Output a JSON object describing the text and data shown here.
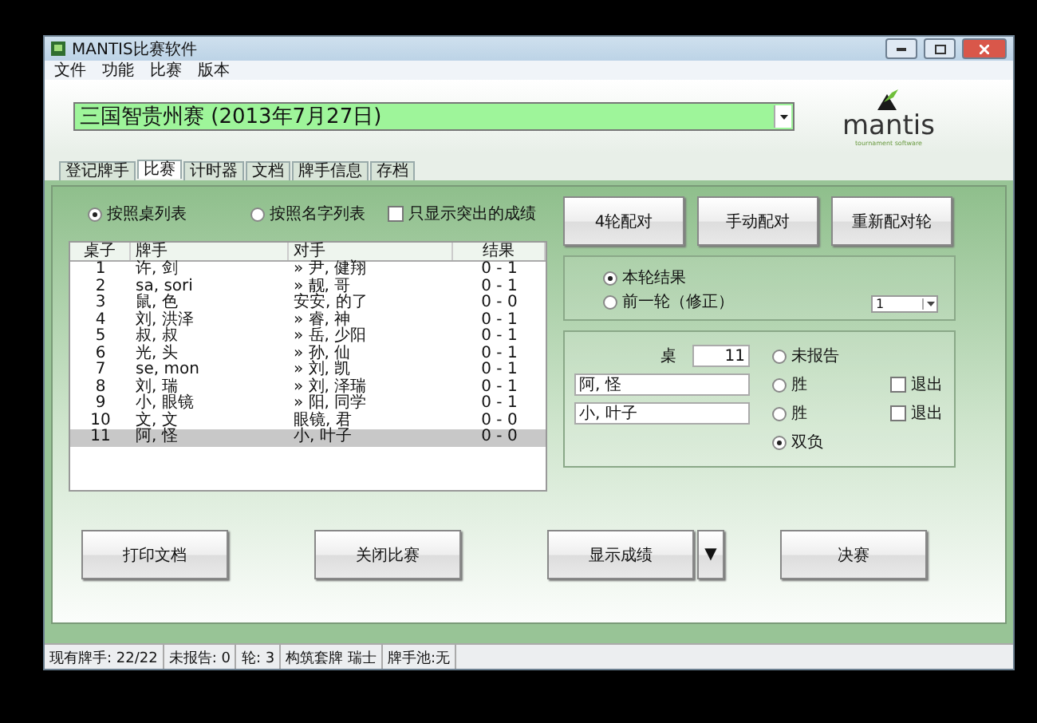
{
  "window": {
    "title": "MANTIS比赛软件"
  },
  "menu": [
    "文件",
    "功能",
    "比赛",
    "版本"
  ],
  "event_select": {
    "value": "三国智贵州赛 (2013年7月27日)"
  },
  "logo": {
    "name": "mantis",
    "tagline": "tournament software"
  },
  "tabs": [
    {
      "label": "登记牌手",
      "selected": false
    },
    {
      "label": "比赛",
      "selected": true
    },
    {
      "label": "计时器",
      "selected": false
    },
    {
      "label": "文档",
      "selected": false
    },
    {
      "label": "牌手信息",
      "selected": false
    },
    {
      "label": "存档",
      "selected": false
    }
  ],
  "sort_options": [
    {
      "label": "按照桌列表",
      "selected": true
    },
    {
      "label": "按照名字列表",
      "selected": false
    }
  ],
  "highlight_only": {
    "label": "只显示突出的成绩",
    "checked": false
  },
  "table": {
    "columns": [
      "桌子",
      "牌手",
      "对手",
      "结果"
    ],
    "rows": [
      {
        "cells": [
          "1",
          "许, 剑",
          "» 尹, 健翔",
          "0 - 1"
        ],
        "selected": false
      },
      {
        "cells": [
          "2",
          "sa, sori",
          "» 靓, 哥",
          "0 - 1"
        ],
        "selected": false
      },
      {
        "cells": [
          "3",
          "鼠, 色",
          "安安, 的了",
          "0 - 0"
        ],
        "selected": false
      },
      {
        "cells": [
          "4",
          "刘, 洪泽",
          "» 睿, 神",
          "0 - 1"
        ],
        "selected": false
      },
      {
        "cells": [
          "5",
          "叔, 叔",
          "» 岳, 少阳",
          "0 - 1"
        ],
        "selected": false
      },
      {
        "cells": [
          "6",
          "光, 头",
          "» 孙, 仙",
          "0 - 1"
        ],
        "selected": false
      },
      {
        "cells": [
          "7",
          "se, mon",
          "» 刘, 凯",
          "0 - 1"
        ],
        "selected": false
      },
      {
        "cells": [
          "8",
          "刘, 瑞",
          "» 刘, 泽瑞",
          "0 - 1"
        ],
        "selected": false
      },
      {
        "cells": [
          "9",
          "小, 眼镜",
          "» 阳, 同学",
          "0 - 1"
        ],
        "selected": false
      },
      {
        "cells": [
          "10",
          "文, 文",
          "眼镜, 君",
          "0 - 0"
        ],
        "selected": false
      },
      {
        "cells": [
          "11",
          "阿, 怪",
          "小, 叶子",
          "0 - 0"
        ],
        "selected": true
      }
    ]
  },
  "pairing_buttons": [
    "4轮配对",
    "手动配对",
    "重新配对轮"
  ],
  "result_round": {
    "options": [
      {
        "label": "本轮结果",
        "selected": true
      },
      {
        "label": "前一轮（修正）",
        "selected": false
      }
    ],
    "round_select": {
      "value": "1"
    }
  },
  "desk": {
    "label": "桌",
    "number": "11",
    "players": [
      "阿, 怪",
      "小, 叶子"
    ],
    "outcomes": [
      {
        "label": "未报告",
        "selected": false
      },
      {
        "label": "胜",
        "selected": false
      },
      {
        "label": "胜",
        "selected": false
      },
      {
        "label": "双负",
        "selected": true
      }
    ],
    "drops": [
      {
        "label": "退出",
        "checked": false
      },
      {
        "label": "退出",
        "checked": false
      }
    ]
  },
  "bottom_buttons": [
    {
      "label": "打印文档",
      "kind": "plain"
    },
    {
      "label": "关闭比赛",
      "kind": "plain"
    },
    {
      "label": "显示成绩",
      "kind": "split",
      "arrow": "▼"
    },
    {
      "label": "决赛",
      "kind": "plain"
    }
  ],
  "status_bar": [
    "现有牌手: 22/22",
    "未报告: 0",
    "轮: 3",
    "构筑套牌 瑞士",
    "牌手池:无"
  ]
}
